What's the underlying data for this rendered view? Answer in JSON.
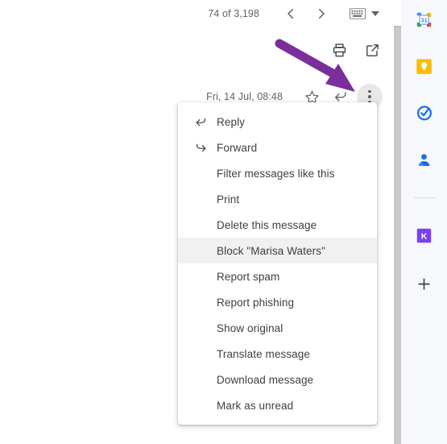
{
  "pager": {
    "count_text": "74 of 3,198",
    "prev_label": "Older",
    "next_label": "Newer",
    "keyboard_icon": "keyboard-icon",
    "caret_icon": "chevron-down-icon"
  },
  "utilities": {
    "print_label": "Print all",
    "print_icon": "printer-icon",
    "popout_label": "Open in new window",
    "popout_icon": "open-in-new-icon"
  },
  "message": {
    "date_text": "Fri, 14 Jul, 08:48",
    "star_label": "Not starred",
    "star_icon": "star-outline-icon",
    "reply_label": "Reply",
    "reply_icon": "reply-arrow-icon",
    "more_label": "More",
    "more_icon": "three-dots-vertical-icon"
  },
  "annotation": {
    "arrow_color": "#7B2D9B",
    "arrow_name": "purple-pointer-arrow"
  },
  "context_menu": {
    "items": [
      {
        "label": "Reply",
        "icon": "reply-arrow-icon",
        "highlighted": false
      },
      {
        "label": "Forward",
        "icon": "forward-arrow-icon",
        "highlighted": false
      },
      {
        "label": "Filter messages like this",
        "icon": "",
        "highlighted": false
      },
      {
        "label": "Print",
        "icon": "",
        "highlighted": false
      },
      {
        "label": "Delete this message",
        "icon": "",
        "highlighted": false
      },
      {
        "label": "Block \"Marisa Waters\"",
        "icon": "",
        "highlighted": true
      },
      {
        "label": "Report spam",
        "icon": "",
        "highlighted": false
      },
      {
        "label": "Report phishing",
        "icon": "",
        "highlighted": false
      },
      {
        "label": "Show original",
        "icon": "",
        "highlighted": false
      },
      {
        "label": "Translate message",
        "icon": "",
        "highlighted": false
      },
      {
        "label": "Download message",
        "icon": "",
        "highlighted": false
      },
      {
        "label": "Mark as unread",
        "icon": "",
        "highlighted": false
      }
    ]
  },
  "app_rail": {
    "items": [
      {
        "name": "google-calendar-icon",
        "label": "Calendar",
        "badge": "31",
        "color": "#1a73e8"
      },
      {
        "name": "google-keep-icon",
        "label": "Keep",
        "badge": "",
        "color": "#fbbc04"
      },
      {
        "name": "google-tasks-icon",
        "label": "Tasks",
        "badge": "",
        "color": "#1a73e8"
      },
      {
        "name": "google-contacts-icon",
        "label": "Contacts",
        "badge": "",
        "color": "#1a73e8"
      },
      {
        "name": "divider",
        "label": "",
        "badge": "",
        "color": ""
      },
      {
        "name": "keep-notes-addon-icon",
        "label": "K",
        "badge": "K",
        "color": "#7e3ff2"
      },
      {
        "name": "add-addon-icon",
        "label": "Get add-ons",
        "badge": "",
        "color": "#3c4043"
      }
    ]
  },
  "scrollbar": {
    "name": "vertical-scrollbar"
  },
  "colors": {
    "rail_background": "#f6f8fc",
    "menu_highlight": "#f1f1f1",
    "text_primary": "#3c4043",
    "text_secondary": "#5f6368"
  }
}
